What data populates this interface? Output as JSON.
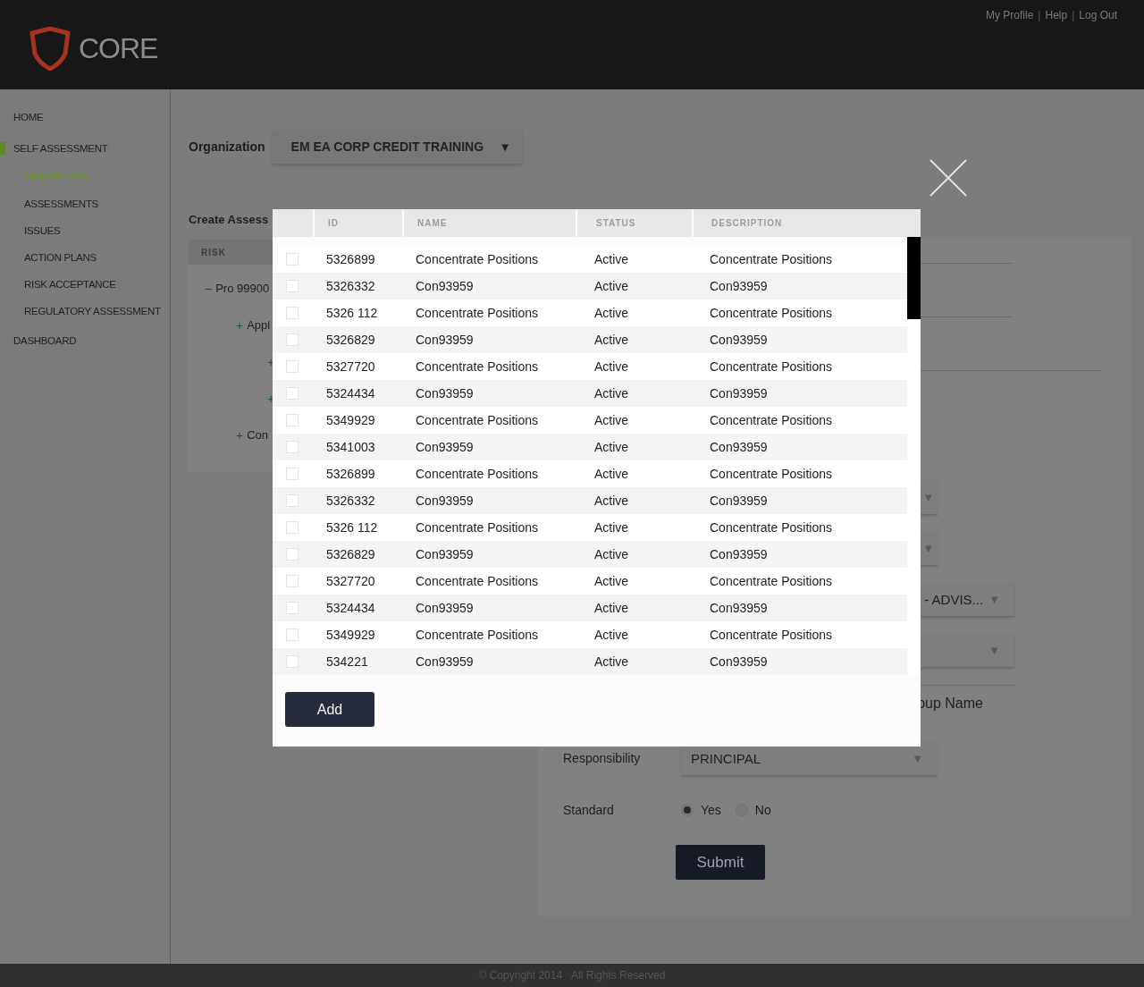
{
  "header": {
    "logo_text": "CORE",
    "links": [
      "My Profile",
      "Help",
      "Log Out"
    ],
    "separator": "|"
  },
  "sidebar": {
    "items": [
      {
        "label": "HOME",
        "selected": false
      },
      {
        "label": "SELF ASSESSMENT",
        "selected": true,
        "children": [
          {
            "label": "CREATE NEW",
            "selected": true
          },
          {
            "label": "ASSESSMENTS",
            "selected": false
          },
          {
            "label": "ISSUES",
            "selected": false
          },
          {
            "label": "ACTION PLANS",
            "selected": false
          },
          {
            "label": "RISK ACCEPTANCE",
            "selected": false
          },
          {
            "label": "REGULATORY ASSESSMENT",
            "selected": false
          }
        ]
      },
      {
        "label": "DASHBOARD",
        "selected": false
      }
    ]
  },
  "organization": {
    "label": "Organization",
    "value": "EM EA CORP CREDIT TRAINING",
    "arrow": "▼"
  },
  "section_title": "Create Assess",
  "risk_tree": {
    "header": "RISK",
    "nodes": [
      {
        "toggle": "−",
        "label": "Pro 99900",
        "children": [
          {
            "toggle": "+",
            "label": "Appl",
            "children": [
              {
                "toggle": "+"
              },
              {
                "toggle": "+"
              }
            ]
          },
          {
            "toggle": "+",
            "label": "Con"
          }
        ]
      }
    ]
  },
  "form": {
    "fields": [
      {
        "kind": "line"
      },
      {
        "kind": "line"
      },
      {
        "kind": "line"
      },
      {
        "kind": "select",
        "arrow": "▼"
      },
      {
        "kind": "select",
        "arrow": "▼"
      },
      {
        "kind": "select",
        "value": "- ADVIS...",
        "arrow": "▼"
      },
      {
        "kind": "select",
        "arrow": "▼"
      },
      {
        "kind": "text",
        "value": "oup Name"
      },
      {
        "kind": "select",
        "label": "Responsibility",
        "value": "PRINCIPAL",
        "arrow": "▼"
      },
      {
        "kind": "radio",
        "label": "Standard",
        "options": [
          {
            "label": "Yes",
            "selected": true
          },
          {
            "label": "No",
            "selected": false
          }
        ]
      },
      {
        "kind": "submit",
        "value": "Submit"
      }
    ]
  },
  "modal": {
    "columns": [
      "ID",
      "NAME",
      "STATUS",
      "DESCRIPTION"
    ],
    "rows": [
      {
        "checked": false,
        "cells": [
          "5326899",
          "Concentrate Positions",
          "Active",
          "Concentrate Positions"
        ]
      },
      {
        "checked": false,
        "cells": [
          "5326332",
          "Con93959",
          "Active",
          "Con93959"
        ]
      },
      {
        "checked": false,
        "cells": [
          "5326 112",
          "Concentrate Positions",
          "Active",
          "Concentrate Positions"
        ]
      },
      {
        "checked": false,
        "cells": [
          "5326829",
          "Con93959",
          "Active",
          "Con93959"
        ]
      },
      {
        "checked": false,
        "cells": [
          "5327720",
          "Concentrate Positions",
          "Active",
          "Concentrate Positions"
        ]
      },
      {
        "checked": false,
        "cells": [
          "5324434",
          "Con93959",
          "Active",
          "Con93959"
        ]
      },
      {
        "checked": false,
        "cells": [
          "5349929",
          "Concentrate Positions",
          "Active",
          "Concentrate Positions"
        ]
      },
      {
        "checked": false,
        "cells": [
          "5341003",
          "Con93959",
          "Active",
          "Con93959"
        ]
      },
      {
        "checked": false,
        "cells": [
          "5326899",
          "Concentrate Positions",
          "Active",
          "Concentrate Positions"
        ]
      },
      {
        "checked": false,
        "cells": [
          "5326332",
          "Con93959",
          "Active",
          "Con93959"
        ]
      },
      {
        "checked": false,
        "cells": [
          "5326 112",
          "Concentrate Positions",
          "Active",
          "Concentrate Positions"
        ]
      },
      {
        "checked": false,
        "cells": [
          "5326829",
          "Con93959",
          "Active",
          "Con93959"
        ]
      },
      {
        "checked": false,
        "cells": [
          "5327720",
          "Concentrate Positions",
          "Active",
          "Concentrate Positions"
        ]
      },
      {
        "checked": false,
        "cells": [
          "5324434",
          "Con93959",
          "Active",
          "Con93959"
        ]
      },
      {
        "checked": false,
        "cells": [
          "5349929",
          "Concentrate Positions",
          "Active",
          "Concentrate Positions"
        ]
      },
      {
        "checked": false,
        "cells": [
          "534221",
          "Con93959",
          "Active",
          "Con93959"
        ]
      }
    ],
    "add_button": "Add"
  },
  "footer": {
    "copyright": "© Copyright 2014",
    "rights": "All Rights Reserved"
  }
}
